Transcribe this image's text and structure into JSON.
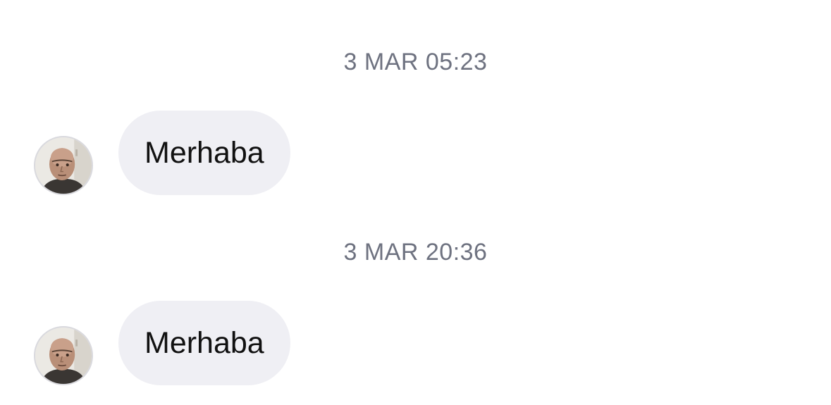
{
  "conversation": {
    "messages": [
      {
        "timestamp": "3 MAR 05:23",
        "text": "Merhaba",
        "sender_avatar": "profile-photo"
      },
      {
        "timestamp": "3 MAR 20:36",
        "text": "Merhaba",
        "sender_avatar": "profile-photo"
      }
    ]
  },
  "colors": {
    "background": "#ffffff",
    "bubble_incoming": "#efeff4",
    "timestamp_text": "#6e7280",
    "message_text": "#111111"
  }
}
